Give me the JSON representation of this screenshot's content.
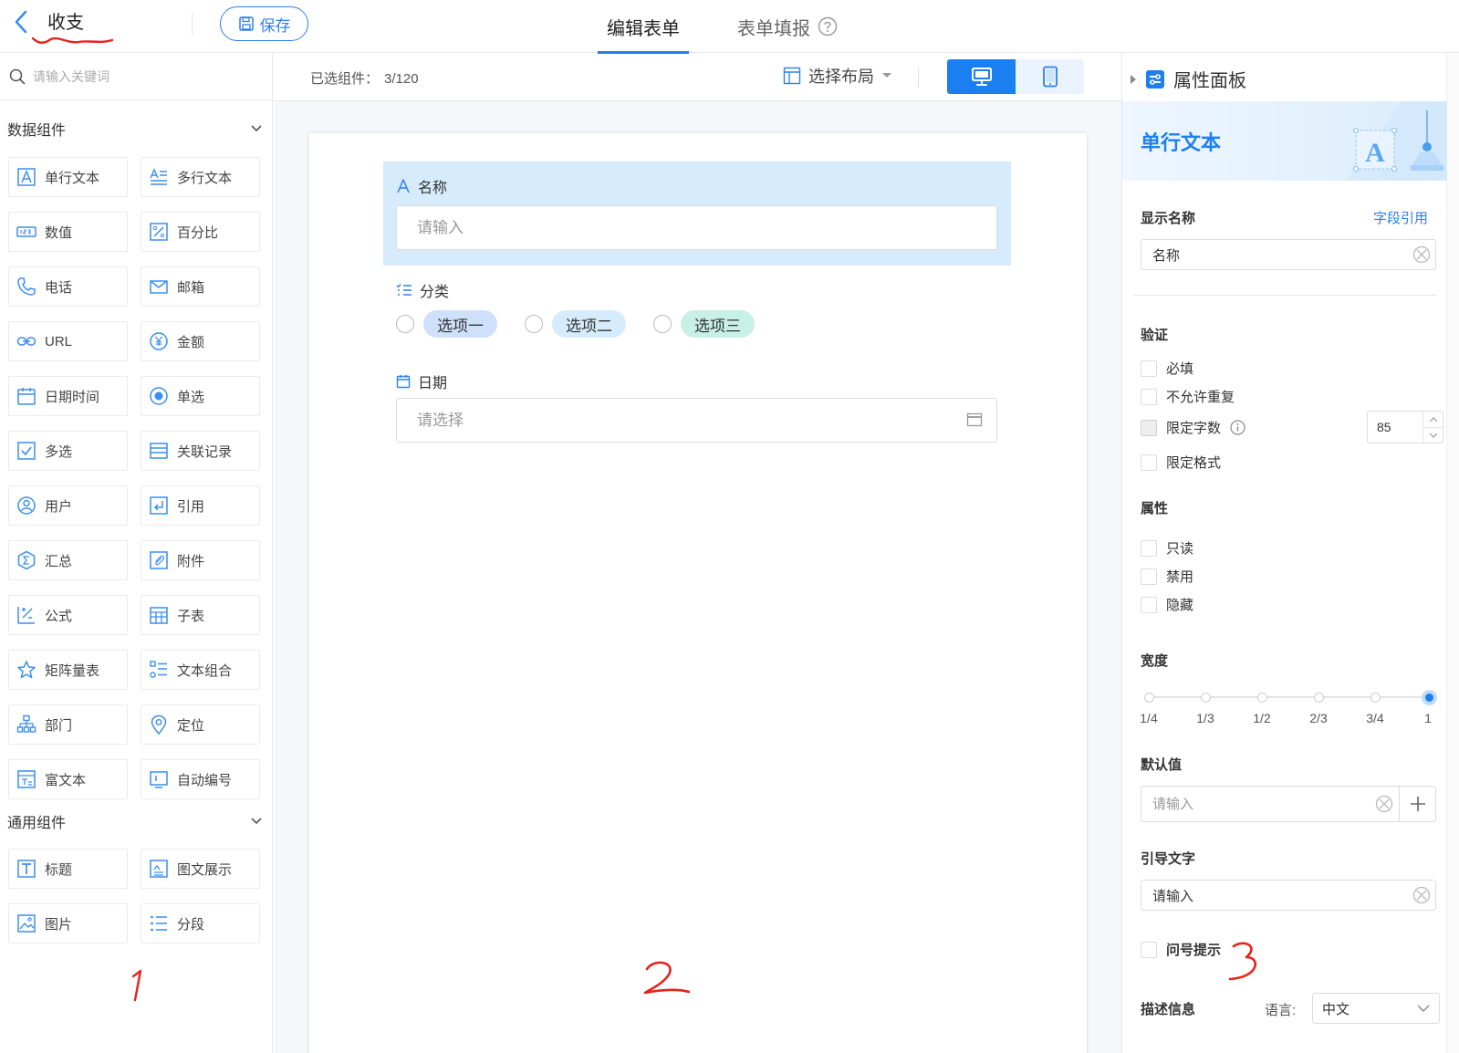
{
  "header": {
    "title": "收支",
    "save_label": "保存",
    "tabs": [
      {
        "label": "编辑表单",
        "active": true
      },
      {
        "label": "表单填报",
        "active": false
      }
    ]
  },
  "left_panel": {
    "search_placeholder": "请输入关键词",
    "data_group": {
      "title": "数据组件",
      "items": [
        {
          "label": "单行文本",
          "icon": "single-line-text-icon"
        },
        {
          "label": "多行文本",
          "icon": "multi-line-text-icon"
        },
        {
          "label": "数值",
          "icon": "number-icon"
        },
        {
          "label": "百分比",
          "icon": "percent-icon"
        },
        {
          "label": "电话",
          "icon": "phone-icon"
        },
        {
          "label": "邮箱",
          "icon": "mail-icon"
        },
        {
          "label": "URL",
          "icon": "link-icon"
        },
        {
          "label": "金额",
          "icon": "currency-icon"
        },
        {
          "label": "日期时间",
          "icon": "calendar-icon"
        },
        {
          "label": "单选",
          "icon": "radio-icon"
        },
        {
          "label": "多选",
          "icon": "checkbox-icon"
        },
        {
          "label": "关联记录",
          "icon": "relation-icon"
        },
        {
          "label": "用户",
          "icon": "user-icon"
        },
        {
          "label": "引用",
          "icon": "reference-icon"
        },
        {
          "label": "汇总",
          "icon": "sum-icon"
        },
        {
          "label": "附件",
          "icon": "attachment-icon"
        },
        {
          "label": "公式",
          "icon": "formula-icon"
        },
        {
          "label": "子表",
          "icon": "subtable-icon"
        },
        {
          "label": "矩阵量表",
          "icon": "matrix-scale-icon"
        },
        {
          "label": "文本组合",
          "icon": "text-combo-icon"
        },
        {
          "label": "部门",
          "icon": "department-icon"
        },
        {
          "label": "定位",
          "icon": "location-icon"
        },
        {
          "label": "富文本",
          "icon": "rich-text-icon"
        },
        {
          "label": "自动编号",
          "icon": "auto-number-icon"
        }
      ]
    },
    "general_group": {
      "title": "通用组件",
      "items": [
        {
          "label": "标题",
          "icon": "heading-icon"
        },
        {
          "label": "图文展示",
          "icon": "image-text-icon"
        },
        {
          "label": "图片",
          "icon": "image-icon"
        },
        {
          "label": "分段",
          "icon": "section-icon"
        }
      ]
    }
  },
  "canvas": {
    "selected_label": "已选组件：",
    "selected_value": "3/120",
    "layout_label": "选择布局",
    "fields": {
      "name": {
        "label": "名称",
        "placeholder": "请输入"
      },
      "category": {
        "label": "分类",
        "options": [
          "选项一",
          "选项二",
          "选项三"
        ]
      },
      "date": {
        "label": "日期",
        "placeholder": "请选择"
      }
    },
    "chip_colors": [
      "#cfe0fb",
      "#d6ecfc",
      "#c8f0e6"
    ]
  },
  "annotations": {
    "one": "1",
    "two": "2",
    "three": "3"
  },
  "right_panel": {
    "title": "属性面板",
    "banner_title": "单行文本",
    "display_name": {
      "label": "显示名称",
      "link": "字段引用",
      "value": "名称"
    },
    "validation": {
      "title": "验证",
      "required": "必填",
      "no_duplicate": "不允许重复",
      "limit_chars": "限定字数",
      "limit_chars_value": "85",
      "limit_format": "限定格式"
    },
    "attributes": {
      "title": "属性",
      "readonly": "只读",
      "disabled": "禁用",
      "hidden": "隐藏"
    },
    "width": {
      "title": "宽度",
      "ticks": [
        "1/4",
        "1/3",
        "1/2",
        "2/3",
        "3/4",
        "1"
      ],
      "selected": "1"
    },
    "default_value": {
      "label": "默认值",
      "placeholder": "请输入"
    },
    "guide_text": {
      "label": "引导文字",
      "value": "请输入"
    },
    "question_tip": "问号提示",
    "description": {
      "label": "描述信息",
      "lang_label": "语言:",
      "lang_value": "中文"
    }
  },
  "colors": {
    "accent": "#1d7ff0",
    "selection": "#d6ebfb",
    "annotation": "#e8231a"
  }
}
